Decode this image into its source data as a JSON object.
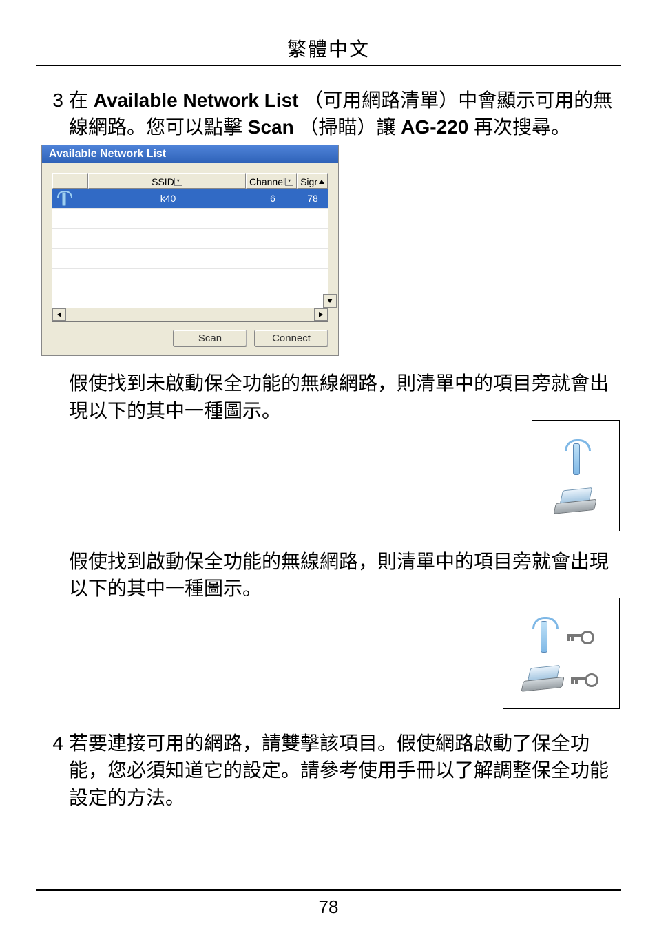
{
  "header": {
    "title": "繁體中文"
  },
  "step3": {
    "num": "3",
    "t_pre": "在 ",
    "t_b1": "Available Network List",
    "t_mid1": " （可用網路清單）中會顯示可用的無線網路。您可以點擊 ",
    "t_b2": "Scan",
    "t_mid2": " （掃瞄）讓 ",
    "t_b3": "AG-220",
    "t_post": " 再次搜尋。"
  },
  "panel": {
    "title": "Available Network List",
    "headers": {
      "ssid": "SSID",
      "channel": "Channel",
      "signal": "Sigr"
    },
    "row": {
      "ssid": "k40",
      "channel": "6",
      "signal": "78"
    },
    "buttons": {
      "scan": "Scan",
      "connect": "Connect"
    }
  },
  "para_unsecured": "假使找到未啟動保全功能的無線網路，則清單中的項目旁就會出現以下的其中一種圖示。",
  "para_secured": "假使找到啟動保全功能的無線網路，則清單中的項目旁就會出現以下的其中一種圖示。",
  "step4": {
    "num": "4",
    "text": "若要連接可用的網路，請雙擊該項目。假使網路啟動了保全功能，您必須知道它的設定。請參考使用手冊以了解調整保全功能設定的方法。"
  },
  "page_number": "78"
}
